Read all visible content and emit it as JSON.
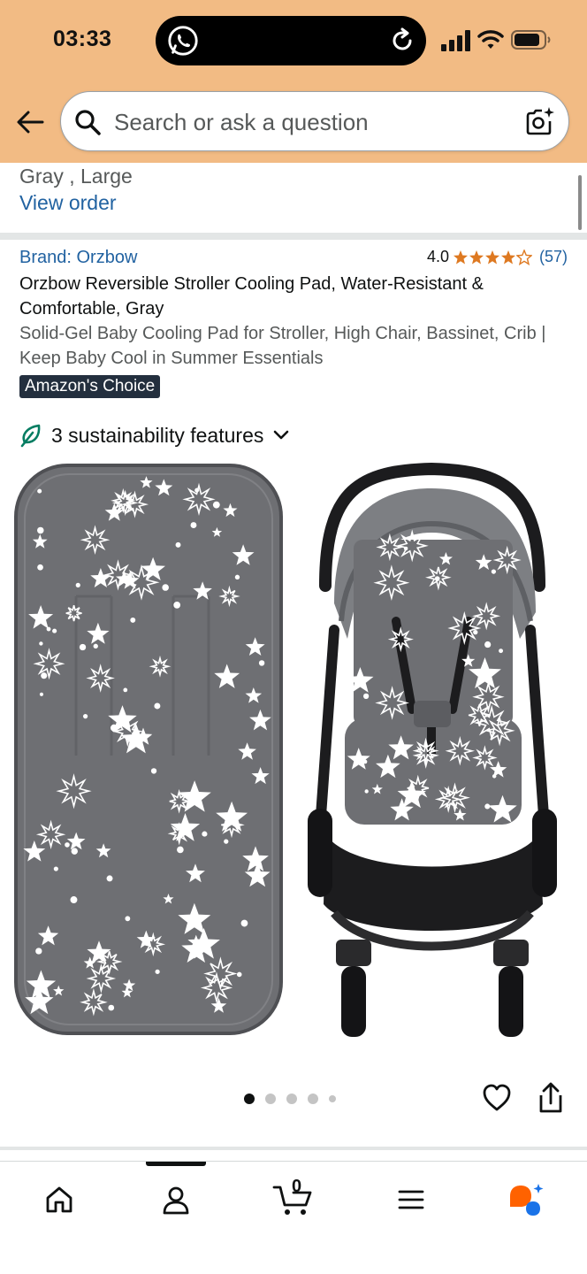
{
  "status_bar": {
    "time": "03:33"
  },
  "header": {
    "search_placeholder": "Search or ask a question",
    "icons": [
      "back-arrow-icon",
      "search-icon",
      "camera-search-icon"
    ]
  },
  "order_strip": {
    "variant": "Gray , Large",
    "view_order_label": "View order"
  },
  "product": {
    "brand": "Brand: Orzbow",
    "rating_value": "4.0",
    "rating_count": "(57)",
    "stars_filled": 4,
    "stars_total": 5,
    "title": "Orzbow Reversible Stroller Cooling Pad, Water-Resistant & Comfortable, Gray",
    "subtitle": "Solid-Gel Baby Cooling Pad for Stroller, High Chair, Bassinet, Crib | Keep Baby Cool in Summer Essentials",
    "badge": "Amazon's Choice",
    "sustainability": "3 sustainability features"
  },
  "gallery": {
    "dot_count": 5,
    "active_dot": 0
  },
  "bottom_nav": {
    "cart_count": "0",
    "items": [
      "home-icon",
      "account-icon",
      "cart-icon",
      "menu-icon",
      "rufus-icon"
    ]
  },
  "colors": {
    "header_bg": "#f2bb84",
    "link": "#2162a1",
    "star": "#de7921",
    "badge_bg": "#232f3e",
    "pad_gray": "#6e6f73",
    "leaf_green": "#067d62",
    "rufus_orange": "#ff6200",
    "rufus_blue": "#1a73e8"
  }
}
